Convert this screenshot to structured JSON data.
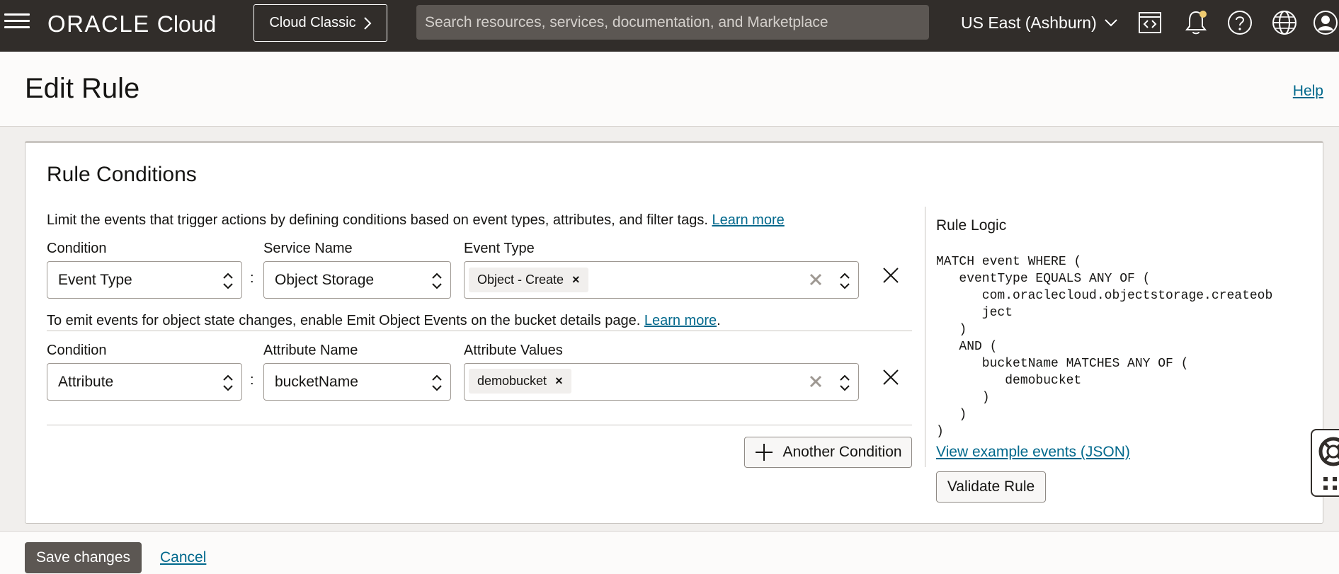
{
  "topbar": {
    "brand_oracle": "ORACLE",
    "brand_cloud": "Cloud",
    "classic_label": "Cloud Classic",
    "search_placeholder": "Search resources, services, documentation, and Marketplace",
    "region": "US East (Ashburn)",
    "icons": [
      "code-editor-icon",
      "notifications-icon",
      "help-icon",
      "language-icon",
      "profile-icon"
    ]
  },
  "header": {
    "title": "Edit Rule",
    "help": "Help"
  },
  "rule_conditions": {
    "title": "Rule Conditions",
    "description": "Limit the events that trigger actions by defining conditions based on event types, attributes, and filter tags.",
    "learn_more": "Learn more",
    "conditions": [
      {
        "condition_label": "Condition",
        "condition_value": "Event Type",
        "name_label": "Service Name",
        "name_value": "Object Storage",
        "values_label": "Event Type",
        "chips": [
          "Object - Create"
        ]
      },
      {
        "condition_label": "Condition",
        "condition_value": "Attribute",
        "name_label": "Attribute Name",
        "name_value": "bucketName",
        "values_label": "Attribute Values",
        "chips": [
          "demobucket"
        ]
      }
    ],
    "colon": ":",
    "hint_text": "To emit events for object state changes, enable Emit Object Events on the bucket details page.",
    "hint_learn_more": "Learn more",
    "hint_period": ".",
    "another_condition": "Another Condition"
  },
  "rule_logic": {
    "title": "Rule Logic",
    "code": "MATCH event WHERE (\n   eventType EQUALS ANY OF (\n      com.oraclecloud.objectstorage.createob\n      ject\n   )\n   AND (\n      bucketName MATCHES ANY OF (\n         demobucket\n      )\n   )\n)",
    "example_link": "View example events (JSON)",
    "validate": "Validate Rule"
  },
  "footer": {
    "save": "Save changes",
    "cancel": "Cancel"
  },
  "colors": {
    "topbar_bg": "#312d2a",
    "link": "#00688c",
    "primary_button": "#5c5753"
  }
}
